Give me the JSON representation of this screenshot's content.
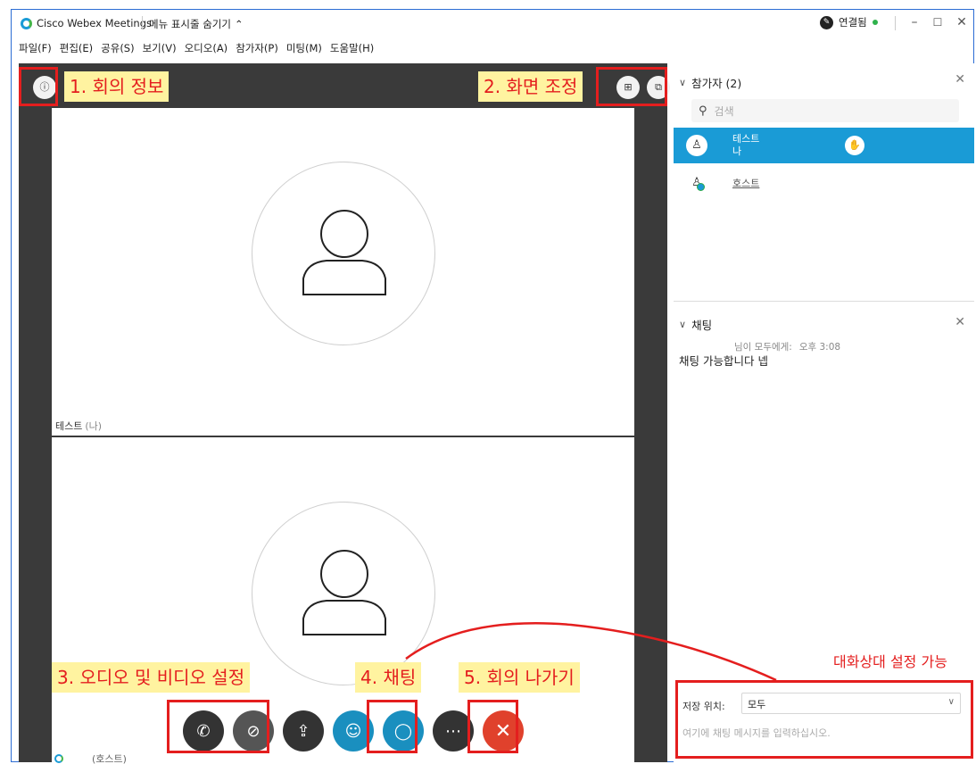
{
  "app": {
    "title": "Cisco Webex Meetings",
    "menu_toggle": "메뉴 표시줄 숨기기",
    "status": "연결됨"
  },
  "menubar": [
    "파일(F)",
    "편집(E)",
    "공유(S)",
    "보기(V)",
    "오디오(A)",
    "참가자(P)",
    "미팅(M)",
    "도움말(H)"
  ],
  "video": {
    "tile1_name": "테스트",
    "tile1_sub": "(나)",
    "tile2_name": "(호스트)"
  },
  "annotations": {
    "meeting_info": "1. 회의 정보",
    "screen_adjust": "2. 화면 조정",
    "audio_video": "3. 오디오 및 비디오 설정",
    "chat": "4. 채팅",
    "leave": "5. 회의 나가기",
    "recipient": "대화상대 설정 가능",
    "color_annotation": "#e41e1e",
    "color_label_bg": "#fff3a0"
  },
  "participants": {
    "header": "참가자 (2)",
    "search_placeholder": "검색",
    "list": [
      {
        "name": "테스트",
        "sub": "나",
        "selected": true
      },
      {
        "name": "호스트",
        "sub": "",
        "selected": false
      }
    ]
  },
  "chat": {
    "header": "채팅",
    "meta_from": "님이 모두에게:",
    "meta_time": "오후 3:08",
    "message": "채팅 가능합니다 넵",
    "to_label": "저장 위치:",
    "to_value": "모두",
    "input_placeholder": "여기에 채팅 메시지를 입력하십시오."
  },
  "colors": {
    "accent": "#1a9bd6",
    "leave": "#e0412c",
    "video_bg": "#3a3a3a"
  }
}
